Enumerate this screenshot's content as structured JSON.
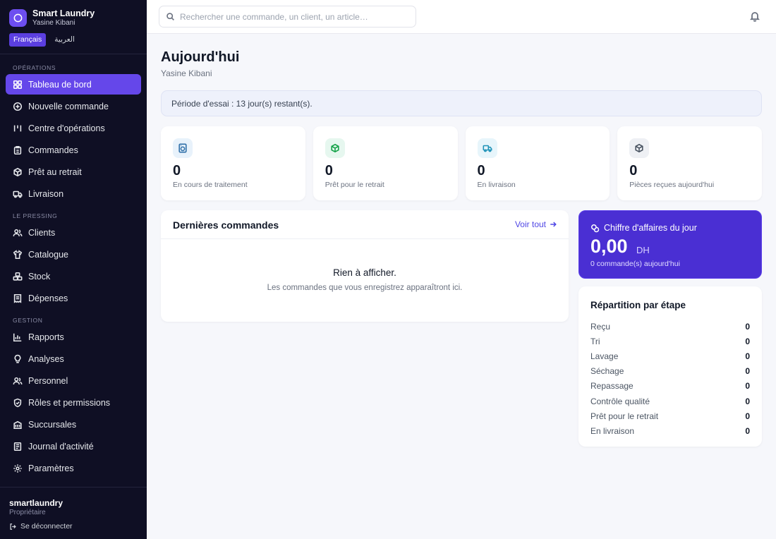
{
  "brand": {
    "title": "Smart Laundry",
    "subtitle": "Yasine Kibani"
  },
  "languages": [
    "Français",
    "العربية"
  ],
  "sidebar": {
    "sections": [
      {
        "title": "OPÉRATIONS",
        "items": [
          "Tableau de bord",
          "Nouvelle commande",
          "Centre d'opérations",
          "Commandes",
          "Prêt au retrait",
          "Livraison"
        ]
      },
      {
        "title": "LE PRESSING",
        "items": [
          "Clients",
          "Catalogue",
          "Stock",
          "Dépenses"
        ]
      },
      {
        "title": "GESTION",
        "items": [
          "Rapports",
          "Analyses",
          "Personnel",
          "Rôles et permissions",
          "Succursales",
          "Journal d'activité",
          "Paramètres"
        ]
      }
    ],
    "footer": {
      "name": "smartlaundry",
      "role": "Propriétaire",
      "logout": "Se déconnecter"
    }
  },
  "search": {
    "placeholder": "Rechercher une commande, un client, un article…"
  },
  "page": {
    "title": "Aujourd'hui",
    "subtitle": "Yasine Kibani"
  },
  "trial_notice": "Période d'essai : 13 jour(s) restant(s).",
  "stats": [
    {
      "value": "0",
      "label": "En cours de traitement"
    },
    {
      "value": "0",
      "label": "Prêt pour le retrait"
    },
    {
      "value": "0",
      "label": "En livraison"
    },
    {
      "value": "0",
      "label": "Pièces reçues aujourd'hui"
    }
  ],
  "recent_orders": {
    "title": "Dernières commandes",
    "see_all": "Voir tout",
    "empty_title": "Rien à afficher.",
    "empty_subtitle": "Les commandes que vous enregistrez apparaîtront ici."
  },
  "revenue": {
    "title": "Chiffre d'affaires du jour",
    "amount": "0,00",
    "currency": "DH",
    "note": "0 commande(s) aujourd'hui"
  },
  "stages": {
    "title": "Répartition par étape",
    "items": [
      {
        "name": "Reçu",
        "value": "0"
      },
      {
        "name": "Tri",
        "value": "0"
      },
      {
        "name": "Lavage",
        "value": "0"
      },
      {
        "name": "Séchage",
        "value": "0"
      },
      {
        "name": "Repassage",
        "value": "0"
      },
      {
        "name": "Contrôle qualité",
        "value": "0"
      },
      {
        "name": "Prêt pour le retrait",
        "value": "0"
      },
      {
        "name": "En livraison",
        "value": "0"
      }
    ]
  },
  "colors": {
    "accent": "#6547ea",
    "sidebar_bg": "#0f0f24",
    "revenue_bg": "#4a2fd3"
  }
}
